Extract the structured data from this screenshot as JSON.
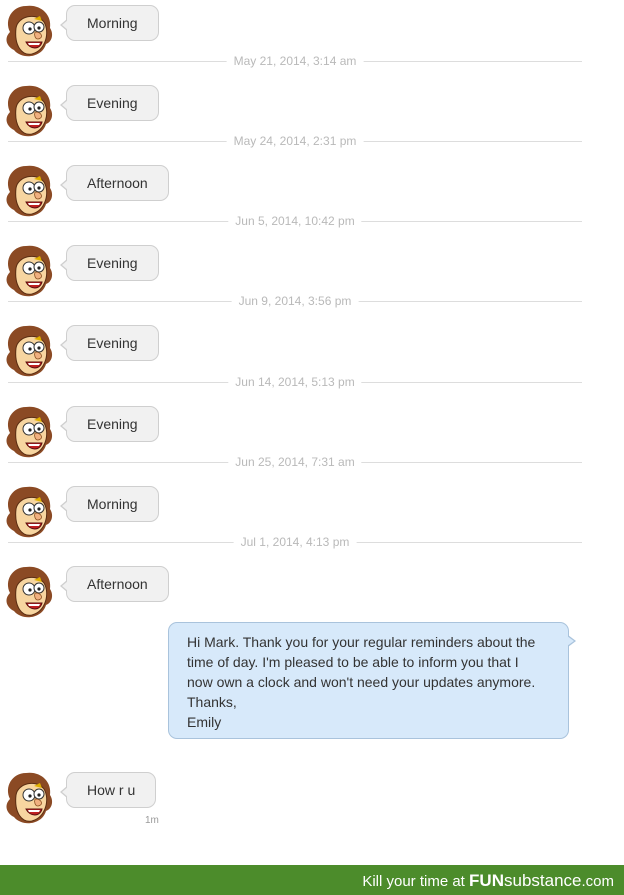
{
  "messages": [
    {
      "text": "Morning"
    },
    {
      "text": "Evening"
    },
    {
      "text": "Afternoon"
    },
    {
      "text": "Evening"
    },
    {
      "text": "Evening"
    },
    {
      "text": "Evening"
    },
    {
      "text": "Morning"
    },
    {
      "text": "Afternoon"
    }
  ],
  "timestamps": [
    "May 21, 2014, 3:14 am",
    "May 24, 2014, 2:31 pm",
    "Jun 5, 2014, 10:42 pm",
    "Jun 9, 2014, 3:56 pm",
    "Jun 14, 2014, 5:13 pm",
    "Jun 25, 2014, 7:31 am",
    "Jul 1, 2014, 4:13 pm"
  ],
  "reply": {
    "lines": [
      "Hi Mark. Thank you for your regular reminders about the",
      "time of day. I'm pleased to be able to inform you that I",
      "now own a clock and won't need your updates anymore.",
      "Thanks,",
      "Emily"
    ]
  },
  "last_message": {
    "text": "How r u",
    "age": "1m"
  },
  "footer": {
    "prefix": "Kill your time at",
    "brand": "FUN",
    "brand_sub": "substance",
    "suffix": ".com"
  },
  "colors": {
    "footer_bg": "#4c8c2b",
    "reply_bubble": "#d7e9fa",
    "incoming_bubble": "#f1f1f1"
  },
  "avatar_icon": "cartoon-face-avatar-icon"
}
